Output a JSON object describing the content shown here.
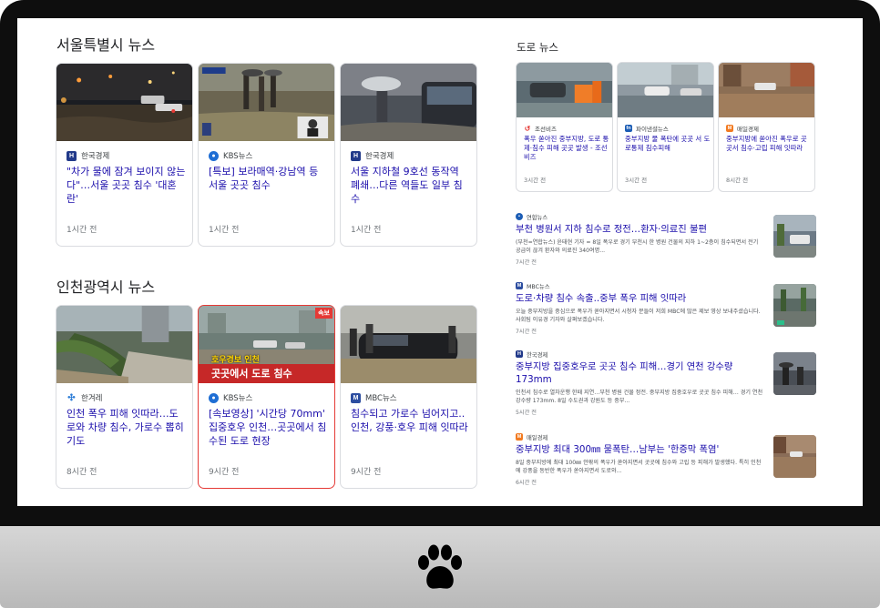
{
  "seoul": {
    "heading": "서울특별시 뉴스",
    "cards": [
      {
        "source": "한국경제",
        "source_icon": "H",
        "title": "\"차가 물에 잠겨 보이지 않는다\"…서울 곳곳 침수 '대혼란'",
        "time": "1시간 전"
      },
      {
        "source": "KBS뉴스",
        "source_icon": "kbs-logo",
        "title": "[특보] 보라매역·강남역 등 서울 곳곳 침수",
        "time": "1시간 전"
      },
      {
        "source": "한국경제",
        "source_icon": "H",
        "title": "서울 지하철 9호선 동작역 폐쇄…다른 역들도 일부 침수",
        "time": "1시간 전"
      }
    ]
  },
  "incheon": {
    "heading": "인천광역시 뉴스",
    "cards": [
      {
        "source": "한겨레",
        "source_icon": "hani-logo",
        "title": "인천 폭우 피해 잇따라…도로와 차량 침수, 가로수 뽑히기도",
        "time": "8시간 전"
      },
      {
        "source": "KBS뉴스",
        "source_icon": "kbs-logo",
        "title": "[속보영상] '시간당 70mm' 집중호우 인천…곳곳에서 침수된 도로 현장",
        "time": "9시간 전",
        "thumb_caption_top": "호우경보 인천",
        "thumb_caption_bottom": "곳곳에서 도로 침수",
        "thumb_badge": "속보"
      },
      {
        "source": "MBC뉴스",
        "source_icon": "mbc-logo",
        "title": "침수되고 가로수 넘어지고..인천, 강풍·호우 피해 잇따라",
        "time": "9시간 전"
      }
    ]
  },
  "road": {
    "heading": "도로 뉴스",
    "cards": [
      {
        "source": "조선비즈",
        "source_icon": "chosun-logo",
        "title": "폭우 쏟아진 중부지방, 도로 통제·침수 피해 곳곳 발생 - 조선비즈",
        "time": "3시간 전"
      },
      {
        "source": "파이낸셜뉴스",
        "source_icon": "fn-logo",
        "title": "중부지방 물 폭탄에 곳곳 서 도로통제 침수피해",
        "time": "3시간 전"
      },
      {
        "source": "매일경제",
        "source_icon": "mk-logo",
        "title": "중부지방에 쏟아진 폭우로 곳곳서 침수·고립 피해 잇따라",
        "time": "8시간 전"
      }
    ],
    "list": [
      {
        "source": "연합뉴스",
        "source_icon": "yonhap-logo",
        "title": "부천 병원서 지하 침수로 정전…환자·의료진 불편",
        "snippet": "(부천=연합뉴스) 윤태현 기자 = 8일 폭우로 경기 부천시 한 병원 건물의 지하 1~2층이 침수되면서 전기 공급이 끊겨 환자와 의료진 340여명...",
        "time": "7시간 전"
      },
      {
        "source": "MBC뉴스",
        "source_icon": "mbc-logo",
        "title": "도로·차량 침수 속출..중부 폭우 피해 잇따라",
        "snippet": "오늘 중부지방을 중심으로 폭우가 쏟아지면서 시청자 분들이 저희 MBC에 많은 제보 영상 보내주셨습니다. 사회팀 이유경 기자와 살펴보겠습니다.",
        "time": "7시간 전"
      },
      {
        "source": "한국경제",
        "source_icon": "H",
        "title": "중부지방 집중호우로 곳곳 침수 피해…경기 연천 강수량 173mm",
        "snippet": "인천서 침수로 열차운행 한때 지연…부천 병원 건물 정전. 중부지방 집중호우로 곳곳 침수 피해… 경기 연천 강수량 173mm. 8일 수도권과 강원도 등 중부...",
        "time": "5시간 전"
      },
      {
        "source": "매일경제",
        "source_icon": "mk-logo",
        "title": "중부지방 최대 300㎜ 물폭탄…남부는 '한증막 폭염'",
        "snippet": "8일 중부지방에 최대 100㎜ 안팎의 폭우가 쏟아지면서 곳곳에 침수와 고립 등 피해가 발생했다. 특히 인천에 강풍을 동반한 폭우가 쏟아지면서 도로와...",
        "time": "6시간 전"
      }
    ]
  },
  "colors": {
    "link": "#1a0dab",
    "time": "#70757a",
    "bezel": "#0e0e0e",
    "chin": "#c8c8c8"
  }
}
